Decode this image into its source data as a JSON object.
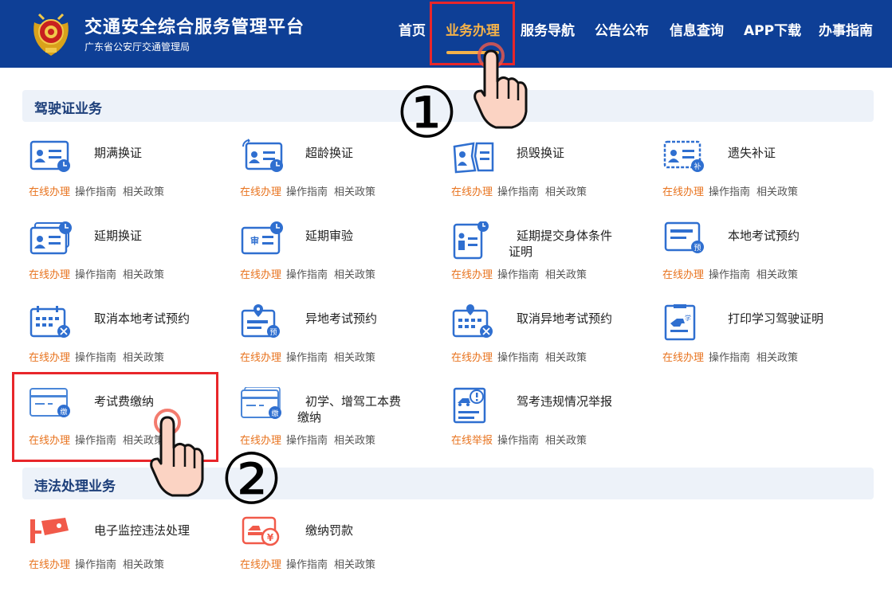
{
  "header": {
    "title": "交通安全综合服务管理平台",
    "subtitle": "广东省公安厅交通管理局",
    "nav": [
      "首页",
      "业务办理",
      "服务导航",
      "公告公布",
      "信息查询",
      "APP下载",
      "办事指南"
    ]
  },
  "sections": [
    {
      "title": "驾驶证业务",
      "items": [
        {
          "name": "期满换证",
          "online": "在线办理",
          "guide": "操作指南",
          "policy": "相关政策",
          "icon": "license-clock-icon"
        },
        {
          "name": "超龄换证",
          "online": "在线办理",
          "guide": "操作指南",
          "policy": "相关政策",
          "icon": "license-refresh-icon"
        },
        {
          "name": "损毁换证",
          "online": "在线办理",
          "guide": "操作指南",
          "policy": "相关政策",
          "icon": "license-broken-icon"
        },
        {
          "name": "遗失补证",
          "online": "在线办理",
          "guide": "操作指南",
          "policy": "相关政策",
          "icon": "license-supplement-icon"
        },
        {
          "name": "延期换证",
          "online": "在线办理",
          "guide": "操作指南",
          "policy": "相关政策",
          "icon": "license-extend-icon"
        },
        {
          "name": "延期审验",
          "online": "在线办理",
          "guide": "操作指南",
          "policy": "相关政策",
          "icon": "review-extend-icon"
        },
        {
          "name": "延期提交身体条件证明",
          "online": "在线办理",
          "guide": "操作指南",
          "policy": "相关政策",
          "icon": "health-certificate-icon"
        },
        {
          "name": "本地考试预约",
          "online": "在线办理",
          "guide": "操作指南",
          "policy": "相关政策",
          "icon": "exam-booking-icon"
        },
        {
          "name": "取消本地考试预约",
          "online": "在线办理",
          "guide": "操作指南",
          "policy": "相关政策",
          "icon": "calendar-cancel-icon"
        },
        {
          "name": "异地考试预约",
          "online": "在线办理",
          "guide": "操作指南",
          "policy": "相关政策",
          "icon": "remote-exam-booking-icon"
        },
        {
          "name": "取消异地考试预约",
          "online": "在线办理",
          "guide": "操作指南",
          "policy": "相关政策",
          "icon": "calendar-location-cancel-icon"
        },
        {
          "name": "打印学习驾驶证明",
          "online": "在线办理",
          "guide": "操作指南",
          "policy": "相关政策",
          "icon": "study-certificate-icon"
        },
        {
          "name": "考试费缴纳",
          "online": "在线办理",
          "guide": "操作指南",
          "policy": "相关政策",
          "icon": "exam-fee-card-icon"
        },
        {
          "name": "初学、增驾工本费缴纳",
          "online": "在线办理",
          "guide": "操作指南",
          "policy": "相关政策",
          "icon": "cost-fee-card-icon"
        },
        {
          "name": "驾考违规情况举报",
          "online": "在线举报",
          "guide": "操作指南",
          "policy": "相关政策",
          "icon": "violation-report-icon"
        }
      ]
    },
    {
      "title": "违法处理业务",
      "items": [
        {
          "name": "电子监控违法处理",
          "online": "在线办理",
          "guide": "操作指南",
          "policy": "相关政策",
          "icon": "surveillance-camera-icon"
        },
        {
          "name": "缴纳罚款",
          "online": "在线办理",
          "guide": "操作指南",
          "policy": "相关政策",
          "icon": "fine-payment-icon"
        }
      ]
    }
  ],
  "annotations": {
    "step1": "①",
    "step2": "②"
  },
  "colors": {
    "header_bg": "#0e3f96",
    "nav_active": "#f4b24a",
    "online_link": "#e8731e",
    "icon_blue": "#2f6fd0",
    "highlight": "#e8262a",
    "section_bg": "#edf2f9"
  }
}
